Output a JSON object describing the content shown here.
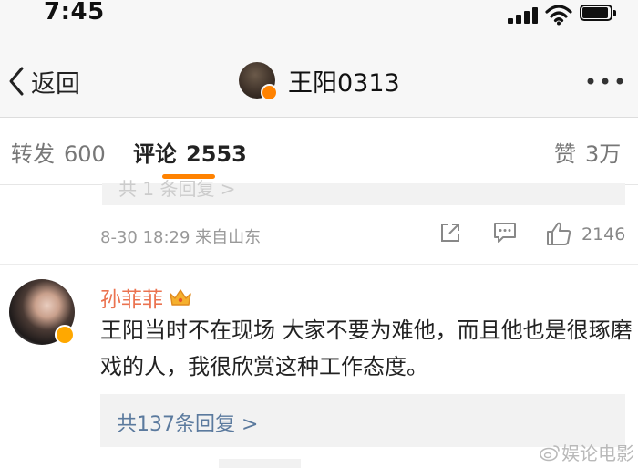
{
  "status_bar": {
    "time": "7:45",
    "signal_icon": "signal-bars-icon",
    "wifi_icon": "wifi-icon",
    "battery_icon": "battery-icon"
  },
  "nav_bar": {
    "back_icon": "chevron-left-icon",
    "back_label": "返回",
    "title": "王阳0313",
    "verified_badge_color": "#ff8200",
    "more_icon": "more-dots-icon"
  },
  "tabs": [
    {
      "label": "转发",
      "count": "600",
      "active": false
    },
    {
      "label": "评论",
      "count": "2553",
      "active": true
    },
    {
      "label": "赞",
      "count": "3万",
      "active": false
    }
  ],
  "accent_color": "#ff8200",
  "previous_comment": {
    "reply_text": "共 1 条回复 >",
    "time_source": "8-30 18:29  来自山东",
    "share_icon": "share-icon",
    "comment_icon": "comment-icon",
    "like_icon": "thumbs-up-icon",
    "like_count": "2146"
  },
  "comment": {
    "username": "孙菲菲",
    "username_color": "#eb7350",
    "member_icon": "crown-icon",
    "verified_badge_color": "#ffa800",
    "text": "王阳当时不在现场 大家不要为难他，而且他也是很琢磨戏的人，我很欣赏这种工作态度。",
    "replies_link": "共137条回复 >"
  },
  "watermark": {
    "icon": "weibo-logo-icon",
    "text": "娱论电影"
  }
}
